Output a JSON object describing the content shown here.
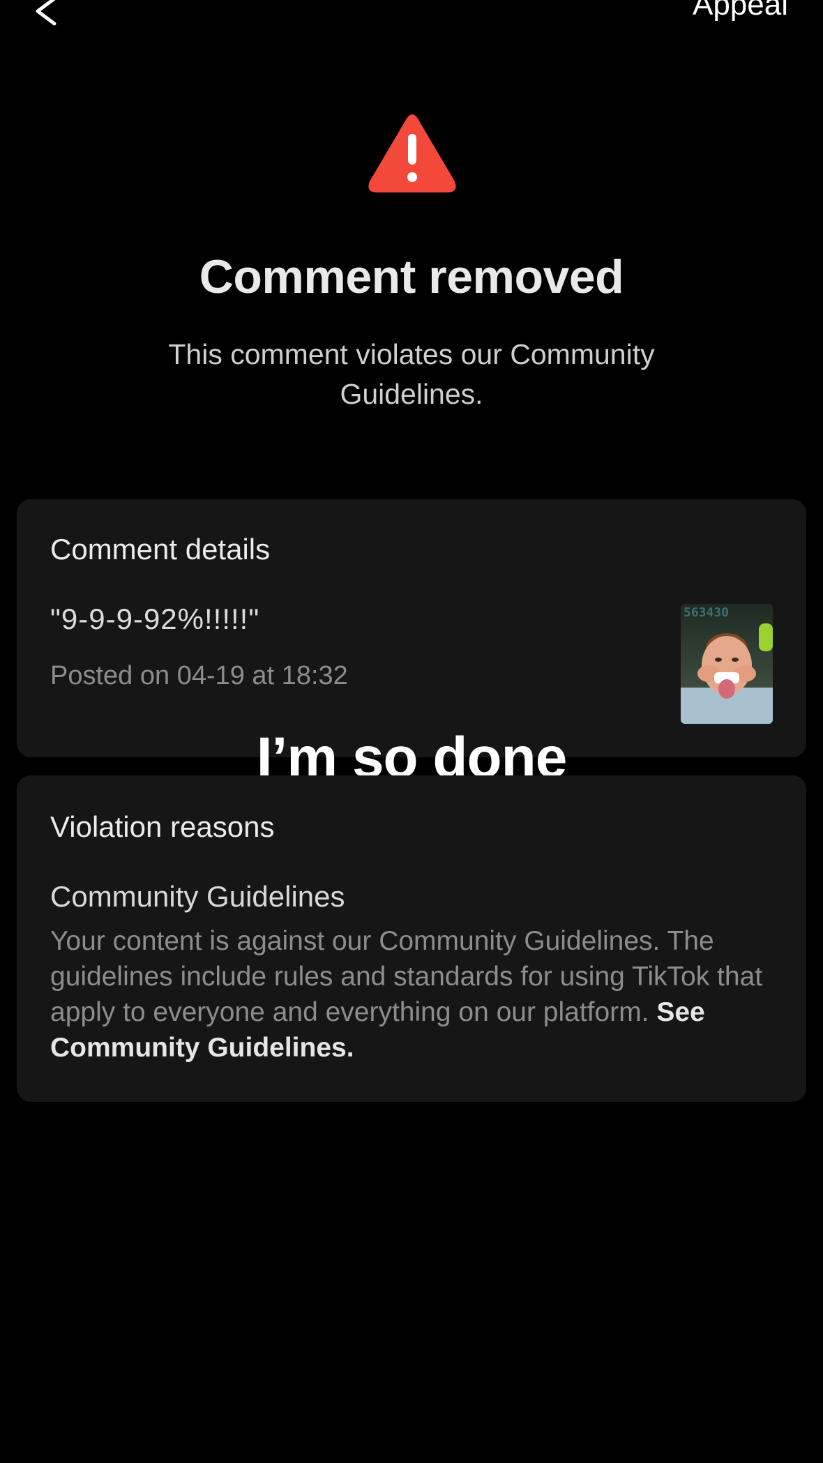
{
  "header": {
    "back_icon": "chevron-left-icon",
    "appeal_label": "Appeal"
  },
  "status": {
    "icon": "warning-triangle-icon",
    "icon_color": "#f2493b",
    "title": "Comment removed",
    "subtitle": "This comment violates our Community Guidelines."
  },
  "comment_details": {
    "heading": "Comment details",
    "comment_text": "\"9-9-9-92%!!!!!\"",
    "posted_on": "Posted on 04-19 at 18:32",
    "thumbnail_counter": "563430"
  },
  "overlay": {
    "caption": "I’m so done"
  },
  "violation": {
    "heading": "Violation reasons",
    "reason_title": "Community Guidelines",
    "reason_body": "Your content is against our Community Guidelines. The guidelines include rules and standards for using TikTok that apply to everyone and everything on our platform. ",
    "link_label": "See Community Guidelines."
  }
}
